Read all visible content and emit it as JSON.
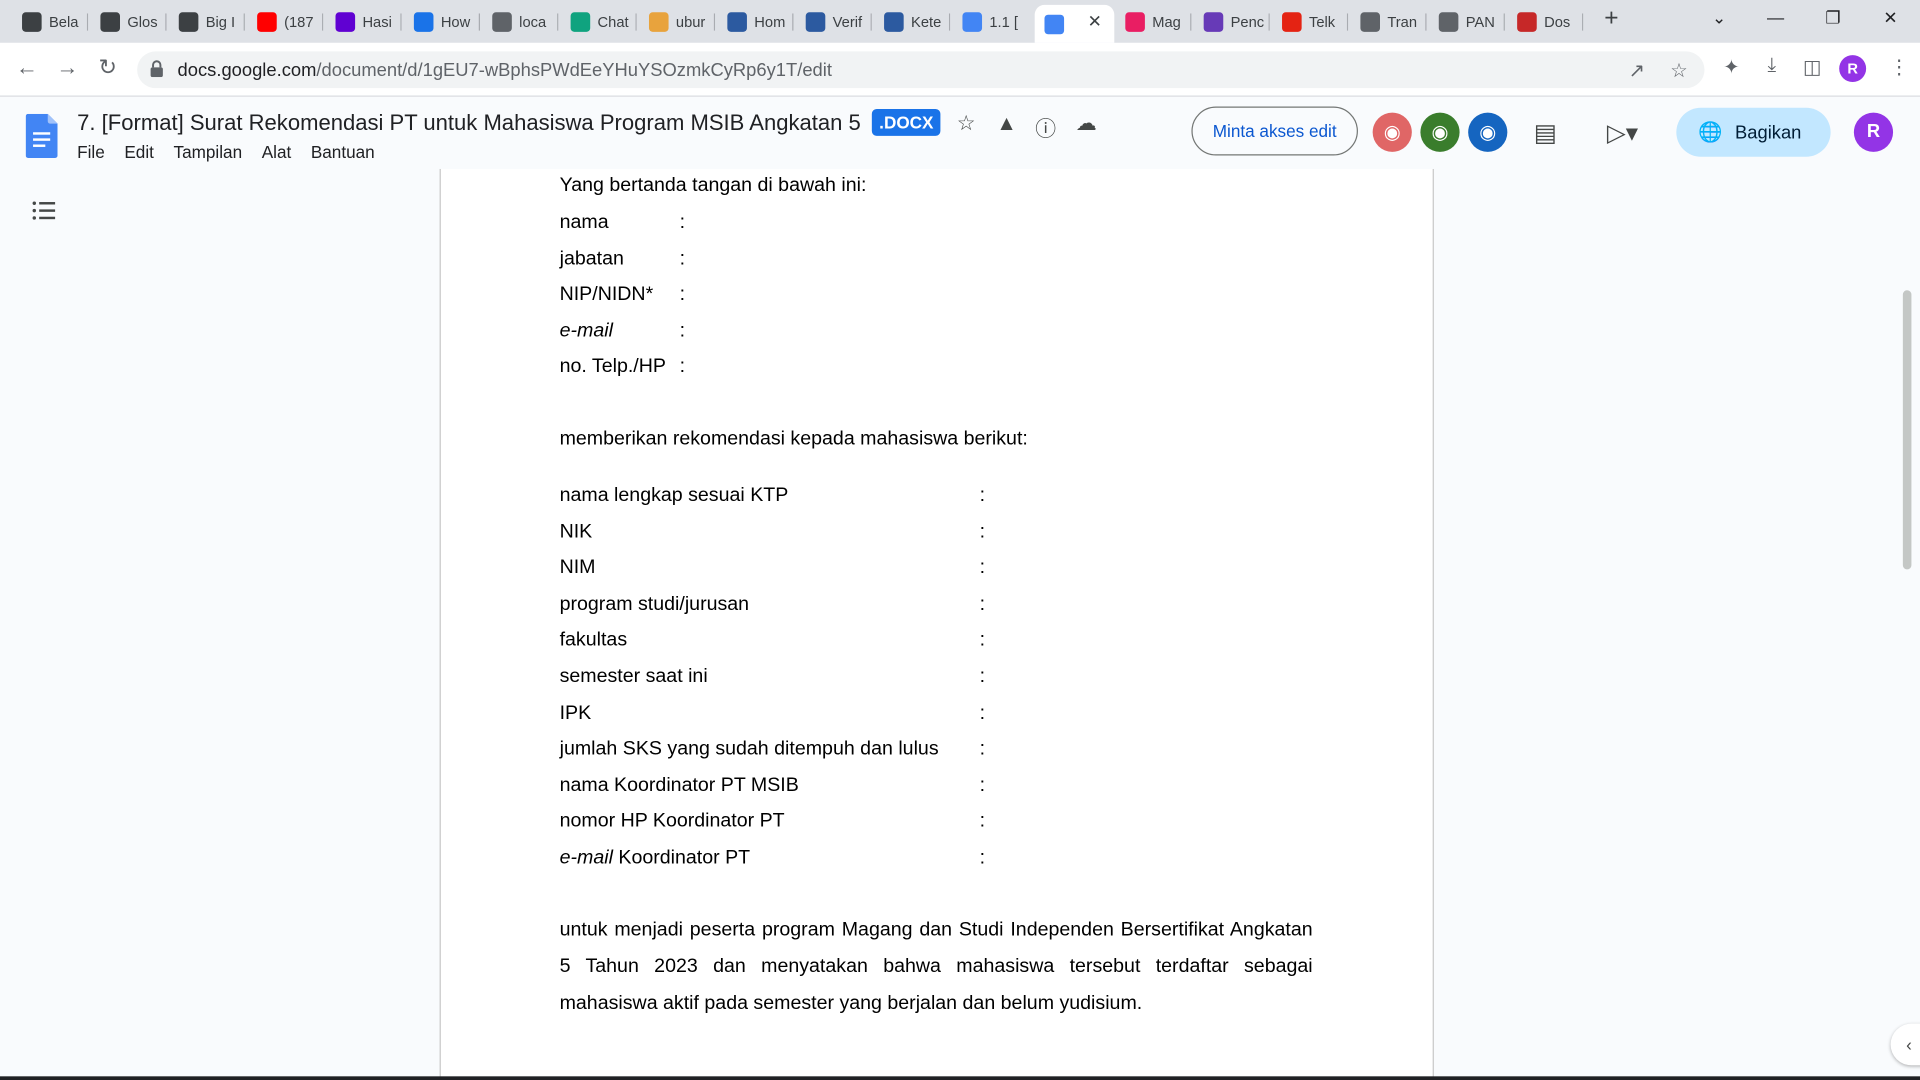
{
  "browser": {
    "tabs": [
      {
        "label": "Bela",
        "favicon": "g-icon",
        "color": "#3c4043"
      },
      {
        "label": "Glos",
        "favicon": "g-icon",
        "color": "#3c4043"
      },
      {
        "label": "Big I",
        "favicon": "g-icon",
        "color": "#3c4043"
      },
      {
        "label": "(187",
        "favicon": "youtube-icon",
        "color": "#ff0000"
      },
      {
        "label": "Hasi",
        "favicon": "yahoo-icon",
        "color": "#6001d2"
      },
      {
        "label": "How",
        "favicon": "lc-icon",
        "color": "#1a73e8"
      },
      {
        "label": "loca",
        "favicon": "globe-icon",
        "color": "#5f6368"
      },
      {
        "label": "Chat",
        "favicon": "chatgpt-icon",
        "color": "#10a37f"
      },
      {
        "label": "ubur",
        "favicon": "ubuntu-forum-icon",
        "color": "#e8a33d"
      },
      {
        "label": "Hom",
        "favicon": "kampus-merdeka-icon",
        "color": "#2c5aa0"
      },
      {
        "label": "Verif",
        "favicon": "kampus-merdeka-icon",
        "color": "#2c5aa0"
      },
      {
        "label": "Kete",
        "favicon": "kampus-merdeka-icon",
        "color": "#2c5aa0"
      },
      {
        "label": "1.1 [",
        "favicon": "docs-icon",
        "color": "#4285f4"
      },
      {
        "label": "",
        "favicon": "docs-icon",
        "color": "#4285f4"
      },
      {
        "label": "Mag",
        "favicon": "magang-icon",
        "color": "#e91e63"
      },
      {
        "label": "Penc",
        "favicon": "forms-icon",
        "color": "#673ab7"
      },
      {
        "label": "Telk",
        "favicon": "telkom-icon",
        "color": "#e42313"
      },
      {
        "label": "Tran",
        "favicon": "globe-icon",
        "color": "#5f6368"
      },
      {
        "label": "PAN",
        "favicon": "globe-icon",
        "color": "#5f6368"
      },
      {
        "label": "Dos",
        "favicon": "shield-icon",
        "color": "#c62828"
      }
    ],
    "url_host": "docs.google.com",
    "url_path": "/document/d/1gEU7-wBphsPWdEeYHuYSOzmkCyRp6y1T/edit",
    "profile_initial": "R"
  },
  "docs": {
    "title": "7. [Format] Surat Rekomendasi PT untuk Mahasiswa Program MSIB Angkatan 5",
    "badge": ".DOCX",
    "menu": [
      "File",
      "Edit",
      "Tampilan",
      "Alat",
      "Bantuan"
    ],
    "request_edit_label": "Minta akses edit",
    "share_label": "Bagikan",
    "user_initial": "R",
    "collaborators": [
      {
        "icon": "anonymous-owl-icon",
        "color": "#e06666"
      },
      {
        "icon": "anonymous-turtle-icon",
        "color": "#3a7d2c"
      },
      {
        "icon": "anonymous-elephant-icon",
        "color": "#1565c0"
      }
    ]
  },
  "document": {
    "intro": "Yang bertanda tangan di bawah ini:",
    "signer_fields": [
      {
        "label": "nama",
        "italic": false,
        "sep": ":"
      },
      {
        "label": "jabatan",
        "italic": false,
        "sep": ":"
      },
      {
        "label": "NIP/NIDN*",
        "italic": false,
        "sep": ":"
      },
      {
        "label": "e-mail",
        "italic": true,
        "sep": ":"
      },
      {
        "label": "no. Telp./HP",
        "italic": false,
        "sep": ":"
      }
    ],
    "recommend_line": "memberikan rekomendasi kepada mahasiswa berikut:",
    "student_fields": [
      {
        "label": "nama lengkap sesuai KTP",
        "sep": ":"
      },
      {
        "label": "NIK",
        "sep": ":"
      },
      {
        "label": "NIM",
        "sep": ":"
      },
      {
        "label": "program studi/jurusan",
        "sep": ":"
      },
      {
        "label": "fakultas",
        "sep": ":"
      },
      {
        "label": "semester saat ini",
        "sep": ":"
      },
      {
        "label": "IPK",
        "sep": ":"
      },
      {
        "label": "jumlah SKS yang sudah ditempuh dan lulus",
        "sep": ":"
      },
      {
        "label": "nama Koordinator PT MSIB",
        "sep": ":"
      },
      {
        "label": "nomor HP Koordinator PT",
        "sep": ":"
      },
      {
        "label_italic": "e-mail",
        "label_rest": " Koordinator PT",
        "sep": ":"
      }
    ],
    "closing": "untuk menjadi peserta program Magang dan Studi Independen Bersertifikat Angkatan 5 Tahun 2023 dan menyatakan bahwa mahasiswa tersebut terdaftar sebagai mahasiswa aktif pada semester yang berjalan dan belum yudisium."
  }
}
